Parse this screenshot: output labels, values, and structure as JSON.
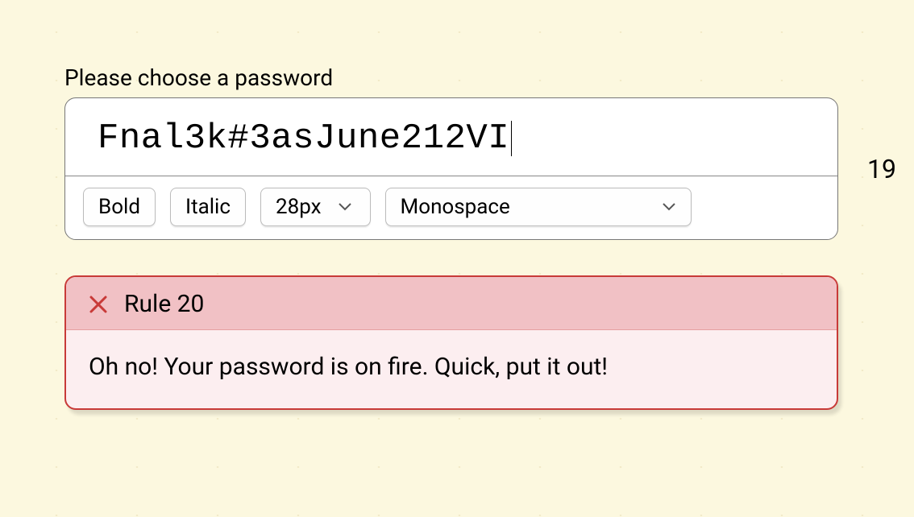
{
  "prompt": "Please choose a password",
  "password": {
    "value": "Fnal3k#3asJune212VI",
    "length": "19"
  },
  "toolbar": {
    "bold_label": "Bold",
    "italic_label": "Italic",
    "fontsize_label": "28px",
    "fontfamily_label": "Monospace"
  },
  "rule": {
    "title": "Rule 20",
    "body": "Oh no! Your password is on fire. Quick, put it out!"
  }
}
